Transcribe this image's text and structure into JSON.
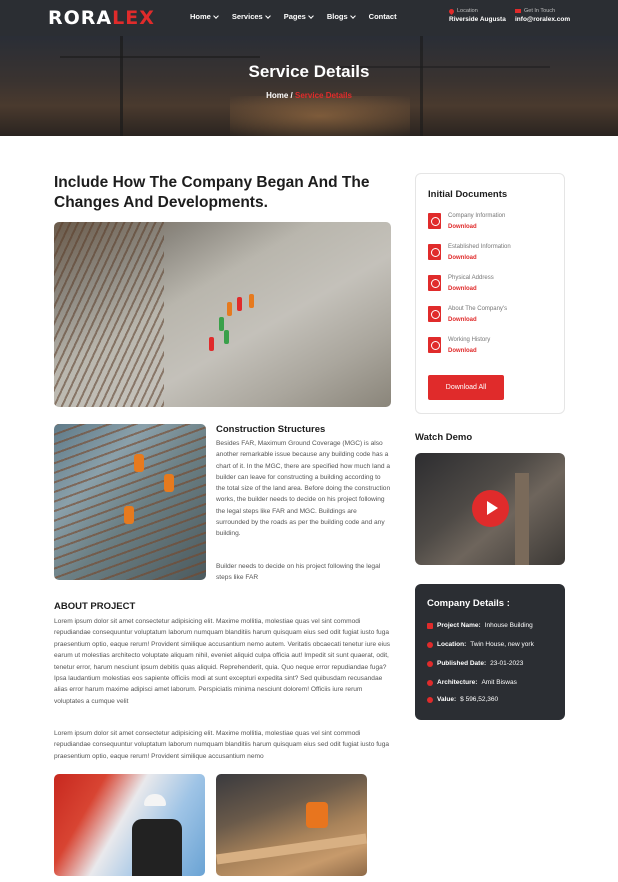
{
  "brand": {
    "logo_text_white": "RORA",
    "logo_text_red": "LEX"
  },
  "nav": {
    "items": [
      {
        "label": "Home",
        "has_dropdown": true
      },
      {
        "label": "Services",
        "has_dropdown": true
      },
      {
        "label": "Pages",
        "has_dropdown": true
      },
      {
        "label": "Blogs",
        "has_dropdown": true
      },
      {
        "label": "Contact",
        "has_dropdown": false
      }
    ]
  },
  "header_info": {
    "location": {
      "label": "Location",
      "value": "Riverside Augusta",
      "icon": "map-pin-icon"
    },
    "contact": {
      "label": "Get In Touch",
      "value": "info@roralex.com",
      "icon": "envelope-icon"
    }
  },
  "hero": {
    "title": "Service Details",
    "breadcrumb_home": "Home",
    "breadcrumb_sep": "/",
    "breadcrumb_current": "Service Details"
  },
  "main": {
    "title": "Include How The Company Began And The Changes And Developments.",
    "construction": {
      "title": "Construction Structures",
      "paragraph1": "Besides FAR, Maximum Ground Coverage (MGC) is also another remarkable issue because any building code has a chart of it. In the MGC, there are specified how much land a builder can leave for constructing a building according to the total size of the land area. Before doing the construction works, the builder needs to decide on his project following the legal steps like FAR and MGC. Buildings are surrounded by the roads as per the building code and any building.",
      "paragraph2": "Builder needs to decide on his project following the legal steps like FAR"
    },
    "about": {
      "title": "ABOUT PROJECT",
      "paragraph1": "Lorem ipsum dolor sit amet consectetur adipisicing elit. Maxime mollitia, molestiae quas vel sint commodi repudiandae consequuntur voluptatum laborum numquam blanditiis harum quisquam eius sed odit fugiat iusto fuga praesentium optio, eaque rerum! Provident similique accusantium nemo autem. Veritatis obcaecati tenetur iure eius earum ut molestias architecto voluptate aliquam nihil, eveniet aliquid culpa officia aut! Impedit sit sunt quaerat, odit, tenetur error, harum nesciunt ipsum debitis quas aliquid. Reprehenderit, quia. Quo neque error repudiandae fuga? Ipsa laudantium molestias eos sapiente officiis modi at sunt excepturi expedita sint? Sed quibusdam recusandae alias error harum maxime adipisci amet laborum. Perspiciatis minima nesciunt dolorem! Officiis iure rerum voluptates a cumque velit",
      "paragraph2": "Lorem ipsum dolor sit amet consectetur adipisicing elit. Maxime mollitia, molestiae quas vel sint commodi repudiandae consequuntur voluptatum laborum numquam blanditiis harum quisquam eius sed odit fugiat iusto fuga praesentium optio, eaque rerum! Provident similique accusantium nemo"
    }
  },
  "sidebar": {
    "docs_title": "Initial Documents",
    "documents": [
      {
        "name": "Company Information",
        "action": "Download",
        "icon": "pdf-icon"
      },
      {
        "name": "Established Information",
        "action": "Download",
        "icon": "pdf-icon"
      },
      {
        "name": "Physical Address",
        "action": "Download",
        "icon": "pdf-icon"
      },
      {
        "name": "About The Company's",
        "action": "Download",
        "icon": "pdf-icon"
      },
      {
        "name": "Working History",
        "action": "Download",
        "icon": "pdf-icon"
      }
    ],
    "download_all": "Download All",
    "watch_title": "Watch Demo",
    "company": {
      "title": "Company Details :",
      "rows": [
        {
          "label": "Project Name:",
          "value": "Inhouse Building",
          "icon": "folder-icon"
        },
        {
          "label": "Location:",
          "value": "Twin House, new york",
          "icon": "map-pin-icon"
        },
        {
          "label": "Published Date:",
          "value": "23-01-2023",
          "icon": "clock-icon"
        },
        {
          "label": "Architecture:",
          "value": "Amit Biswas",
          "icon": "user-icon"
        },
        {
          "label": "Value:",
          "value": "$ 596,52,360",
          "icon": "dollar-icon"
        }
      ]
    }
  },
  "colors": {
    "accent": "#e02b2b",
    "dark": "#2b2e33"
  }
}
